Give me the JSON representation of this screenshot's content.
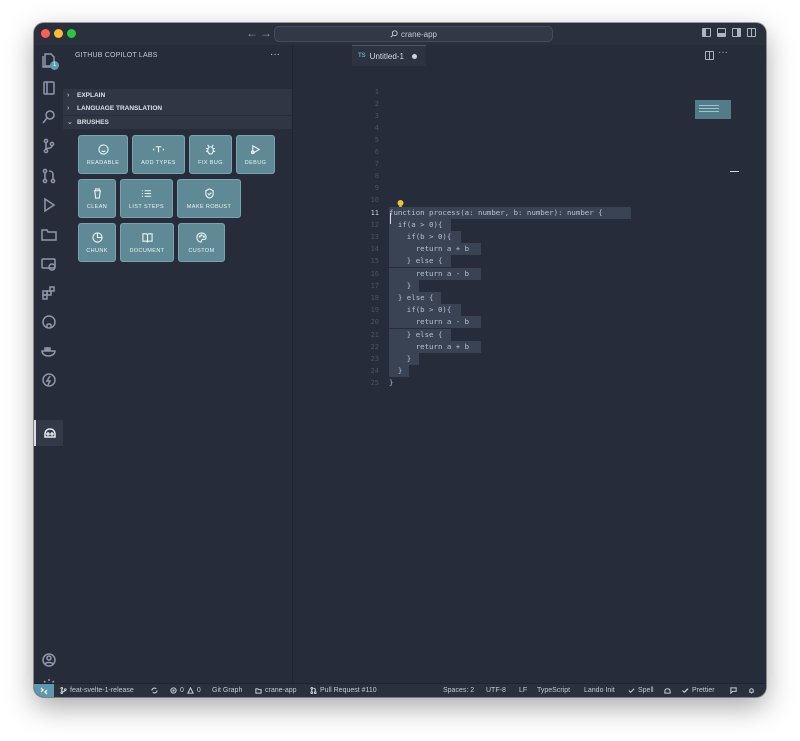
{
  "window": {
    "search_label": "crane-app"
  },
  "sidebar": {
    "title": "GITHUB COPILOT LABS",
    "more": "···",
    "sections": [
      {
        "label": "EXPLAIN",
        "expanded": false
      },
      {
        "label": "LANGUAGE TRANSLATION",
        "expanded": false
      },
      {
        "label": "BRUSHES",
        "expanded": true
      }
    ],
    "brushes": [
      "READABLE",
      "ADD TYPES",
      "FIX BUG",
      "DEBUG",
      "CLEAN",
      "LIST STEPS",
      "MAKE ROBUST",
      "CHUNK",
      "DOCUMENT",
      "CUSTOM"
    ],
    "activity_badge": "1"
  },
  "editor": {
    "tab": {
      "lang": "TS",
      "title": "Untitled-1",
      "dirty": true
    },
    "more": "···",
    "line_numbers": [
      "1",
      "2",
      "3",
      "4",
      "5",
      "6",
      "7",
      "8",
      "9",
      "10",
      "11",
      "12",
      "13",
      "14",
      "15",
      "16",
      "17",
      "18",
      "19",
      "20",
      "21",
      "22",
      "23",
      "24",
      "25"
    ],
    "active_line": "11",
    "code": [
      "function process(a: number, b: number): number {",
      "  if(a > 0){",
      "    if(b > 0){",
      "      return a + b",
      "    } else {",
      "      return a - b",
      "    }",
      "  } else {",
      "    if(b > 0){",
      "      return a - b",
      "    } else {",
      "      return a + b",
      "    }",
      "  }",
      "}"
    ]
  },
  "statusbar": {
    "branch": "feat-svelte-1-release",
    "problems": "0",
    "warnings": "0",
    "git_graph": "Git Graph",
    "project": "crane-app",
    "pull_request": "Pull Request #110",
    "spaces": "Spaces: 2",
    "encoding": "UTF-8",
    "eol": "LF",
    "language": "TypeScript",
    "lando": "Lando Init",
    "spell": "Spell",
    "prettier": "Prettier"
  },
  "colors": {
    "brush_bg": "#5f8a95",
    "accent": "#5e97b0",
    "background": "#262c39"
  }
}
